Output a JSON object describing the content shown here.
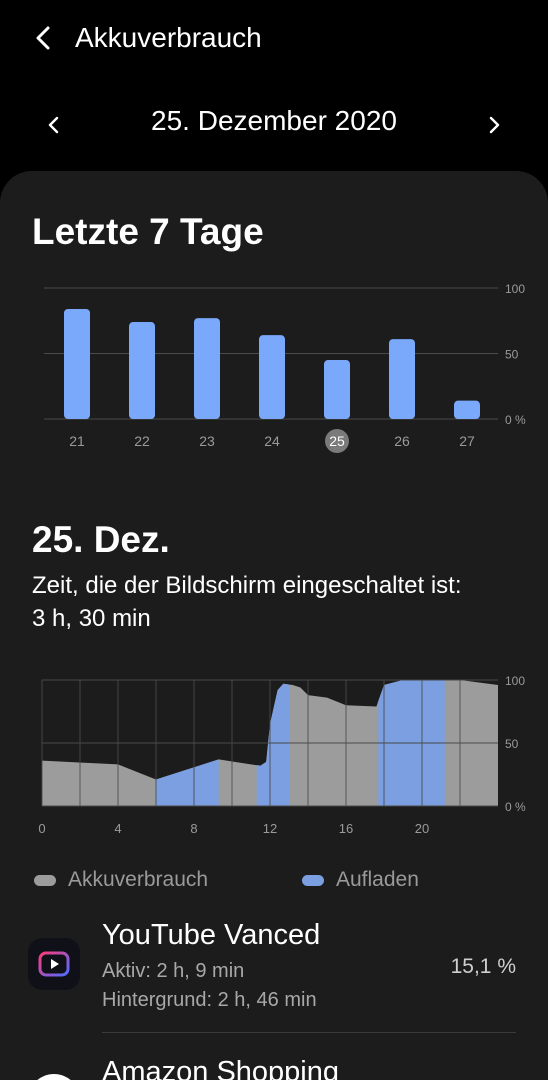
{
  "header": {
    "title": "Akkuverbrauch"
  },
  "date_nav": {
    "label": "25. Dezember 2020"
  },
  "week": {
    "heading": "Letzte 7 Tage",
    "chart_data": {
      "type": "bar",
      "categories": [
        "21",
        "22",
        "23",
        "24",
        "25",
        "26",
        "27"
      ],
      "values": [
        84,
        74,
        77,
        64,
        45,
        61,
        14
      ],
      "selected": "25",
      "ylim": [
        0,
        100
      ],
      "yticks": [
        "100",
        "50",
        "0 %"
      ],
      "color": "#7aa8fb"
    }
  },
  "day": {
    "heading": "25. Dez.",
    "screen_on_text": "Zeit, die der Bildschirm eingeschaltet ist:",
    "screen_on_value": "3 h, 30 min",
    "chart_data": {
      "type": "area",
      "xlim": [
        0,
        24
      ],
      "ylim": [
        0,
        100
      ],
      "xticks": [
        "0",
        "4",
        "8",
        "12",
        "16",
        "20"
      ],
      "yticks": [
        "100",
        "50",
        "0 %"
      ],
      "series": [
        {
          "name": "Akkuverbrauch",
          "color": "#9c9c9c",
          "points": [
            [
              0,
              36
            ],
            [
              4,
              33
            ],
            [
              6,
              21
            ],
            [
              9.3,
              37
            ],
            [
              11,
              33
            ],
            [
              11.5,
              32
            ],
            [
              11.8,
              35
            ],
            [
              12,
              65
            ],
            [
              12.4,
              92
            ],
            [
              12.7,
              97
            ],
            [
              13.2,
              96
            ],
            [
              13.6,
              94
            ],
            [
              14,
              88
            ],
            [
              15,
              86
            ],
            [
              16,
              80
            ],
            [
              17.6,
              79
            ],
            [
              18,
              96
            ],
            [
              19,
              100
            ],
            [
              22,
              100
            ],
            [
              24,
              96
            ]
          ]
        },
        {
          "name": "Aufladen",
          "color": "#7b9fe0",
          "ranges": [
            [
              6,
              9.3
            ],
            [
              11.3,
              13
            ],
            [
              17.7,
              21.2
            ]
          ]
        }
      ]
    }
  },
  "legend": {
    "usage": "Akkuverbrauch",
    "charging": "Aufladen"
  },
  "apps": [
    {
      "name": "YouTube Vanced",
      "active": "Aktiv: 2 h, 9 min",
      "background": "Hintergrund: 2 h, 46 min",
      "percent": "15,1 %"
    },
    {
      "name": "Amazon Shopping"
    }
  ]
}
